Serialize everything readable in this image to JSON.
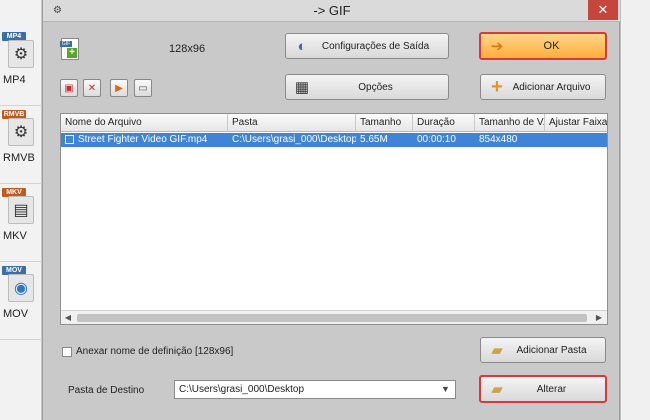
{
  "left_formats": [
    {
      "tag": "MP4",
      "label": "MP4",
      "icon": "film-reel-icon",
      "tag_color": "#3b6ea5"
    },
    {
      "tag": "RMVB",
      "label": "RMVB",
      "icon": "film-reel-icon",
      "tag_color": "#c05a1e"
    },
    {
      "tag": "MKV",
      "label": "MKV",
      "icon": "film-strip-icon",
      "tag_color": "#c05a1e"
    },
    {
      "tag": "MOV",
      "label": "MOV",
      "icon": "quicktime-icon",
      "tag_color": "#3b6ea5"
    }
  ],
  "dialog": {
    "title": "-> GIF",
    "close_label": "✕",
    "resolution": "128x96"
  },
  "buttons": {
    "output_settings": "Configurações de Saída",
    "ok": "OK",
    "options": "Opções",
    "add_file": "Adicionar Arquivo",
    "add_folder": "Adicionar Pasta",
    "change": "Alterar"
  },
  "table": {
    "columns": [
      "Nome do Arquivo",
      "Pasta",
      "Tamanho",
      "Duração",
      "Tamanho de V...",
      "Ajustar Faixa"
    ],
    "rows": [
      {
        "name": "Street Fighter Video GIF.mp4",
        "folder": "C:\\Users\\grasi_000\\Desktop",
        "size": "5.65M",
        "duration": "00:00:10",
        "video_size": "854x480",
        "range": ""
      }
    ]
  },
  "append_definition_label": "Anexar nome de definição [128x96]",
  "destination": {
    "label": "Pasta de Destino",
    "value": "C:\\Users\\grasi_000\\Desktop"
  },
  "colors": {
    "highlight_border": "#d83a3a",
    "ok_fill": "#ffb84d",
    "selected_row": "#3f84d6"
  }
}
